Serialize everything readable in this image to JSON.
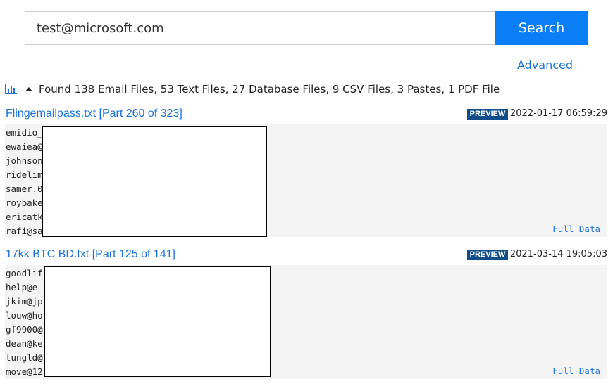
{
  "search": {
    "query": "test@microsoft.com",
    "button_label": "Search",
    "advanced_label": "Advanced"
  },
  "summary": {
    "text": "Found 138 Email Files, 53 Text Files, 27 Database Files, 9 CSV Files, 3 Pastes, 1 PDF File",
    "chart_icon": "bar-chart-icon",
    "toggle_icon": "caret-up-icon"
  },
  "results": [
    {
      "title": "Flingemailpass.txt [Part 260 of 323]",
      "badge": "PREVIEW",
      "date": "2022-01-17 06:59:29",
      "lines": [
        "emidio_",
        "ewaiea@",
        "johnson",
        "ridelim",
        "samer.0",
        "roybake",
        "ericatk",
        "rafi@sa"
      ],
      "full_data_label": "Full Data"
    },
    {
      "title": "17kk BTC BD.txt [Part 125 of 141]",
      "badge": "PREVIEW",
      "date": "2021-03-14 19:05:03",
      "lines": [
        "goodlif",
        "help@e-",
        "jkim@jp",
        "louw@ho",
        "gf9900@",
        "dean@ke",
        "tungld@",
        "move@12"
      ],
      "full_data_label": "Full Data"
    }
  ],
  "colors": {
    "accent": "#0a7ff5",
    "link": "#1a73d9",
    "badge": "#0f4c8a",
    "panel": "#f4f4f4"
  }
}
